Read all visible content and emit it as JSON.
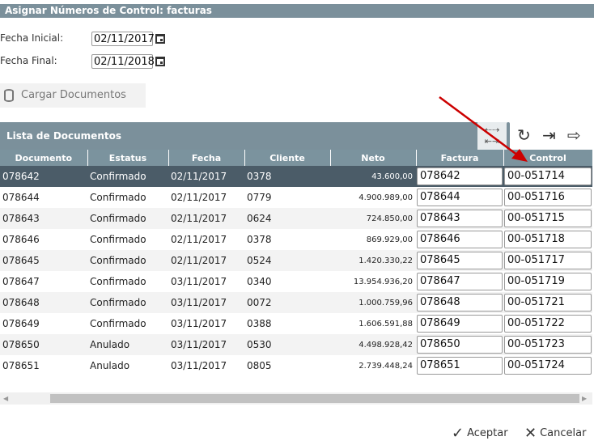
{
  "title": "Asignar Números de Control: facturas",
  "form": {
    "fecha_inicial_label": "Fecha Inicial:",
    "fecha_inicial": "02/11/2017",
    "fecha_final_label": "Fecha Final:",
    "fecha_final": "02/11/2018",
    "cargar_label": "Cargar Documentos"
  },
  "panel": {
    "title": "Lista de Documentos"
  },
  "columns": [
    "Documento",
    "Estatus",
    "Fecha",
    "Cliente",
    "Neto",
    "Factura",
    "Control"
  ],
  "rows": [
    [
      "078642",
      "Confirmado",
      "02/11/2017",
      "0378",
      "43.600,00",
      "078642",
      "00-051714"
    ],
    [
      "078644",
      "Confirmado",
      "02/11/2017",
      "0779",
      "4.900.989,00",
      "078644",
      "00-051716"
    ],
    [
      "078643",
      "Confirmado",
      "02/11/2017",
      "0624",
      "724.850,00",
      "078643",
      "00-051715"
    ],
    [
      "078646",
      "Confirmado",
      "02/11/2017",
      "0378",
      "869.929,00",
      "078646",
      "00-051718"
    ],
    [
      "078645",
      "Confirmado",
      "02/11/2017",
      "0524",
      "1.420.330,22",
      "078645",
      "00-051717"
    ],
    [
      "078647",
      "Confirmado",
      "03/11/2017",
      "0340",
      "13.954.936,20",
      "078647",
      "00-051719"
    ],
    [
      "078648",
      "Confirmado",
      "03/11/2017",
      "0072",
      "1.000.759,96",
      "078648",
      "00-051721"
    ],
    [
      "078649",
      "Confirmado",
      "03/11/2017",
      "0388",
      "1.606.591,88",
      "078649",
      "00-051722"
    ],
    [
      "078650",
      "Anulado",
      "03/11/2017",
      "0530",
      "4.498.928,42",
      "078650",
      "00-051723"
    ],
    [
      "078651",
      "Anulado",
      "03/11/2017",
      "0805",
      "2.739.448,24",
      "078651",
      "00-051724"
    ]
  ],
  "actions": {
    "accept": "Aceptar",
    "cancel": "Cancelar"
  }
}
